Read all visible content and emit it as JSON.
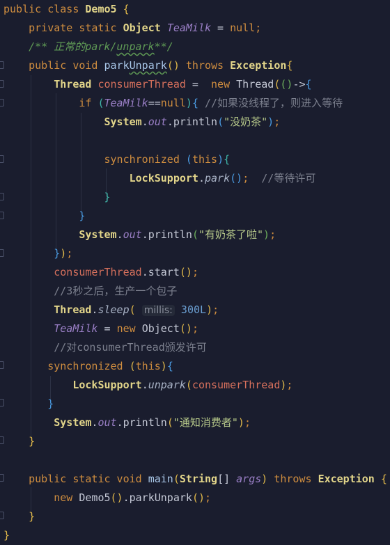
{
  "editor": {
    "colors": {
      "background": "#1a1d2e",
      "keyword": "#cf8d3f",
      "class": "#e2d58a",
      "static_field": "#9a7fc6",
      "comment": "#7c808e",
      "doc_comment": "#5f9a55",
      "string": "#b7c98a",
      "number": "#6b9fd2"
    },
    "lines": [
      [
        [
          "kw",
          "public class "
        ],
        [
          "cls",
          "Demo5"
        ],
        [
          "b1",
          " {"
        ]
      ],
      [
        [
          "kw",
          "    private static "
        ],
        [
          "cls",
          "Object "
        ],
        [
          "fld",
          "TeaMilk"
        ],
        [
          "txt",
          " = "
        ],
        [
          "kw",
          "null;"
        ]
      ],
      [
        [
          "doc",
          "    /** 正常的park/"
        ],
        [
          "doc wavy",
          "unpark"
        ],
        [
          "doc",
          "**/"
        ]
      ],
      [
        [
          "kw",
          "    public void "
        ],
        [
          "mth",
          "park"
        ],
        [
          "mth wavy",
          "Unpark"
        ],
        [
          "b1",
          "()"
        ],
        [
          "kw",
          " throws "
        ],
        [
          "cls",
          "Exception"
        ],
        [
          "b1",
          "{"
        ]
      ],
      [
        [
          "cls",
          "        Thread "
        ],
        [
          "var",
          "consumerThread"
        ],
        [
          "txt",
          " =  "
        ],
        [
          "kw",
          "new "
        ],
        [
          "txt",
          "Thread"
        ],
        [
          "b1",
          "("
        ],
        [
          "b2",
          "()"
        ],
        [
          "txt",
          "->"
        ],
        [
          "b3",
          "{"
        ]
      ],
      [
        [
          "kw",
          "            if "
        ],
        [
          "b4",
          "("
        ],
        [
          "fld",
          "TeaMilk"
        ],
        [
          "txt",
          "=="
        ],
        [
          "kw",
          "null"
        ],
        [
          "b4",
          ")"
        ],
        [
          "b3",
          "{ "
        ],
        [
          "cmt",
          "//如果没线程了，则进入等待"
        ]
      ],
      [
        [
          "cls",
          "                System"
        ],
        [
          "txt",
          "."
        ],
        [
          "fld",
          "out"
        ],
        [
          "txt",
          ".println"
        ],
        [
          "b3",
          "("
        ],
        [
          "str",
          "\"没奶茶\""
        ],
        [
          "b3",
          ")"
        ],
        [
          "kw",
          ";"
        ]
      ],
      [],
      [
        [
          "kw",
          "                synchronized "
        ],
        [
          "b3",
          "("
        ],
        [
          "kw",
          "this"
        ],
        [
          "b3",
          ")"
        ],
        [
          "b4",
          "{"
        ]
      ],
      [
        [
          "cls",
          "                    LockSupport"
        ],
        [
          "txt",
          "."
        ],
        [
          "smth",
          "park"
        ],
        [
          "b3",
          "()"
        ],
        [
          "kw",
          ";"
        ],
        [
          "cmt",
          "  //等待许可"
        ]
      ],
      [
        [
          "b4",
          "                }"
        ]
      ],
      [
        [
          "b3",
          "            }"
        ]
      ],
      [
        [
          "cls",
          "            System"
        ],
        [
          "txt",
          "."
        ],
        [
          "fld",
          "out"
        ],
        [
          "txt",
          ".println"
        ],
        [
          "b2",
          "("
        ],
        [
          "str",
          "\"有奶茶了啦\""
        ],
        [
          "b2",
          ")"
        ],
        [
          "kw",
          ";"
        ]
      ],
      [
        [
          "b3",
          "        }"
        ],
        [
          "b1",
          ")"
        ],
        [
          "kw",
          ";"
        ]
      ],
      [
        [
          "var",
          "        consumerThread"
        ],
        [
          "txt",
          ".start"
        ],
        [
          "b1",
          "()"
        ],
        [
          "kw",
          ";"
        ]
      ],
      [
        [
          "cmt",
          "        //3秒之后，生产一个包子"
        ]
      ],
      [
        [
          "cls",
          "        Thread"
        ],
        [
          "txt",
          "."
        ],
        [
          "smth",
          "sleep"
        ],
        [
          "b1",
          "( "
        ],
        [
          "hint",
          "millis:"
        ],
        [
          "num",
          " 300L"
        ],
        [
          "b1",
          ")"
        ],
        [
          "kw",
          ";"
        ]
      ],
      [
        [
          "fld",
          "        TeaMilk"
        ],
        [
          "txt",
          " = "
        ],
        [
          "kw",
          "new "
        ],
        [
          "txt",
          "Object"
        ],
        [
          "b1",
          "()"
        ],
        [
          "kw",
          ";"
        ]
      ],
      [
        [
          "cmt",
          "        //对consumerThread颁发许可"
        ]
      ],
      [
        [
          "kw",
          "       synchronized "
        ],
        [
          "b1",
          "("
        ],
        [
          "kw",
          "this"
        ],
        [
          "b1",
          ")"
        ],
        [
          "b3",
          "{"
        ]
      ],
      [
        [
          "cls",
          "           LockSupport"
        ],
        [
          "txt",
          "."
        ],
        [
          "smth",
          "unpark"
        ],
        [
          "b1",
          "("
        ],
        [
          "var",
          "consumerThread"
        ],
        [
          "b1",
          ")"
        ],
        [
          "kw",
          ";"
        ]
      ],
      [
        [
          "b3",
          "       }"
        ]
      ],
      [
        [
          "cls",
          "        System"
        ],
        [
          "txt",
          "."
        ],
        [
          "fld",
          "out"
        ],
        [
          "txt",
          ".println"
        ],
        [
          "b1",
          "("
        ],
        [
          "str",
          "\"通知消费者\""
        ],
        [
          "b1",
          ")"
        ],
        [
          "kw",
          ";"
        ]
      ],
      [
        [
          "b1",
          "    }"
        ]
      ],
      [],
      [
        [
          "kw",
          "    public static void "
        ],
        [
          "mth",
          "main"
        ],
        [
          "b1",
          "("
        ],
        [
          "cls",
          "String"
        ],
        [
          "txt",
          "[] "
        ],
        [
          "fld",
          "args"
        ],
        [
          "b1",
          ")"
        ],
        [
          "kw",
          " throws "
        ],
        [
          "cls",
          "Exception "
        ],
        [
          "b1",
          "{"
        ]
      ],
      [
        [
          "kw",
          "        new "
        ],
        [
          "txt",
          "Demo5"
        ],
        [
          "b1",
          "()"
        ],
        [
          "txt",
          ".parkUnpark"
        ],
        [
          "b1",
          "()"
        ],
        [
          "kw",
          ";"
        ]
      ],
      [
        [
          "b1",
          "    }"
        ]
      ],
      [
        [
          "b1",
          "}"
        ]
      ]
    ]
  }
}
